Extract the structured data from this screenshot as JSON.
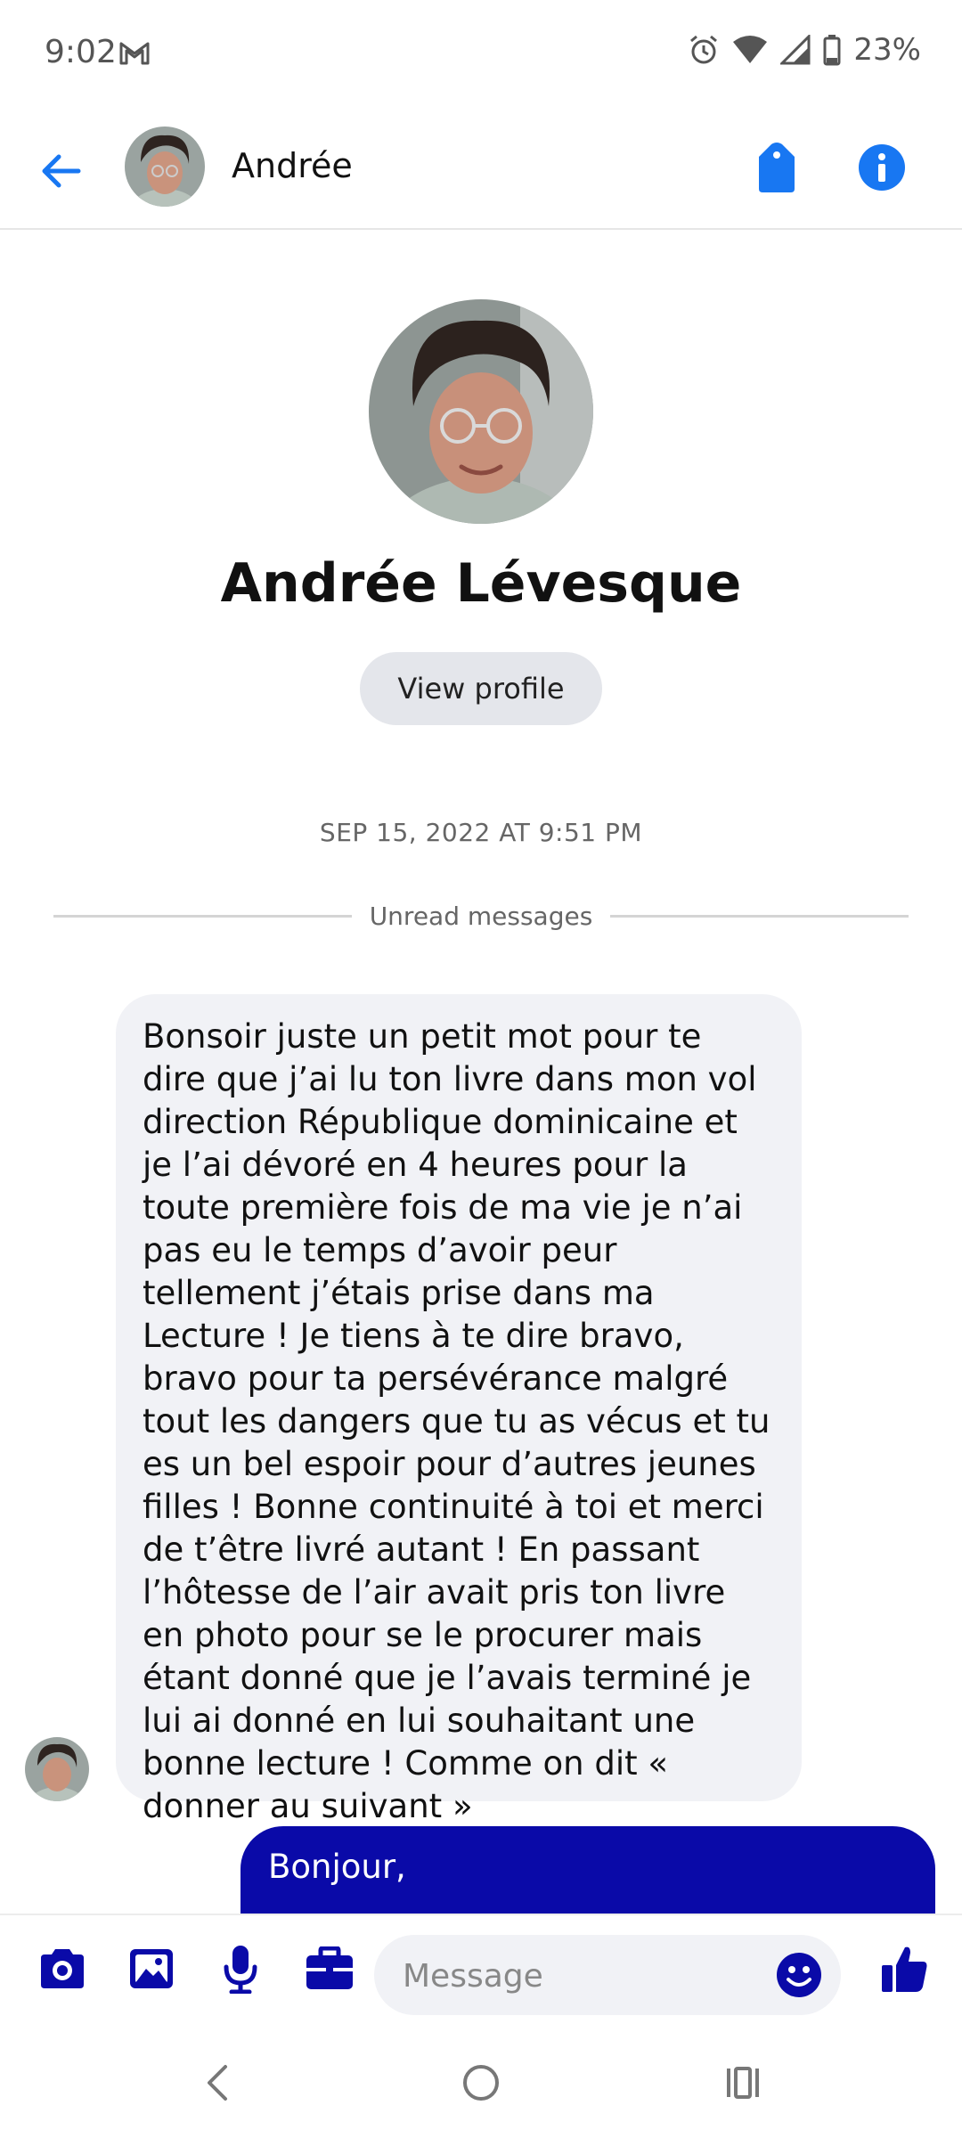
{
  "status_bar": {
    "time": "9:02",
    "battery": "23%",
    "icons": [
      "gmail-icon",
      "alarm-icon",
      "wifi-icon",
      "signal-icon",
      "battery-icon"
    ]
  },
  "header": {
    "name": "Andrée",
    "icons": [
      "back-arrow-icon",
      "tag-icon",
      "info-icon"
    ],
    "accent_color": "#1877f2"
  },
  "profile": {
    "full_name": "Andrée Lévesque",
    "view_profile_label": "View profile"
  },
  "conversation": {
    "timestamp": "SEP 15, 2022 AT 9:51 PM",
    "unread_label": "Unread messages",
    "messages": [
      {
        "direction": "incoming",
        "text": "Bonsoir juste un petit mot pour te dire que j’ai lu ton livre dans mon vol direction République dominicaine et je l’ai dévoré en 4 heures pour la toute première fois de ma vie je n’ai pas eu le temps d’avoir peur tellement j’étais prise dans ma\nLecture ! Je tiens à te dire bravo, bravo pour ta persévérance malgré tout les dangers que tu as vécus et tu es un bel espoir pour d’autres jeunes filles ! Bonne continuité à toi et merci de t’être livré autant ! En passant l’hôtesse de l’air avait pris ton livre en photo pour se le procurer mais étant donné que je l’avais terminé je lui ai donné en lui souhaitant une bonne lecture ! Comme on dit « donner au suivant »"
      },
      {
        "direction": "outgoing",
        "text": "Bonjour,"
      }
    ],
    "incoming_bubble_color": "#f1f2f6",
    "outgoing_bubble_color": "#0a0aa8"
  },
  "composer": {
    "placeholder": "Message",
    "icons": [
      "camera-icon",
      "gallery-icon",
      "microphone-icon",
      "briefcase-icon",
      "emoji-icon",
      "thumbs-up-icon"
    ],
    "icon_color": "#0a0aa8"
  },
  "nav_bar": {
    "icons": [
      "back-nav-icon",
      "home-nav-icon",
      "recents-nav-icon"
    ]
  }
}
